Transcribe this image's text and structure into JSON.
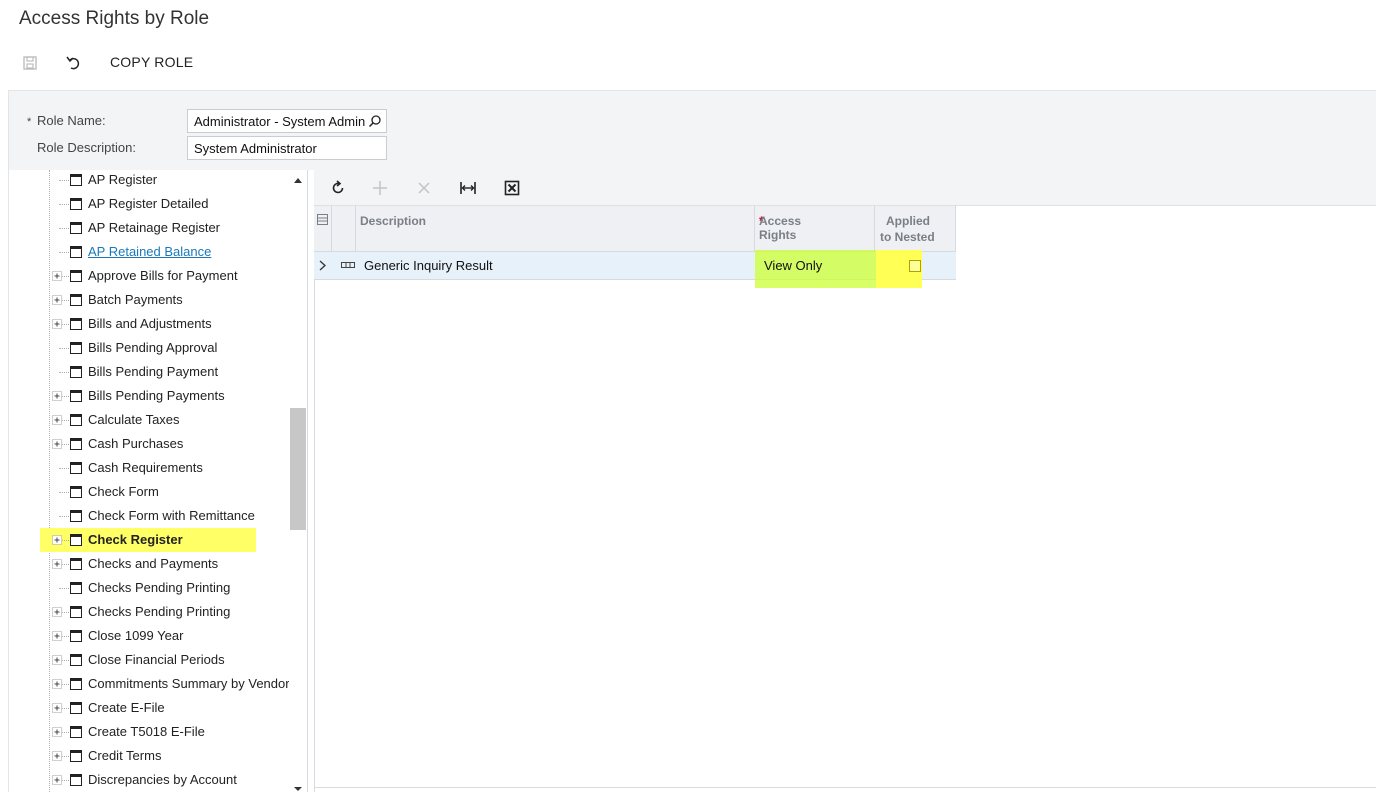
{
  "page": {
    "title": "Access Rights by Role"
  },
  "toolbar": {
    "copy_role_label": "COPY ROLE"
  },
  "form": {
    "role_name_label": "Role Name:",
    "role_name_value": "Administrator - System Admin",
    "role_description_label": "Role Description:",
    "role_description_value": "System Administrator",
    "required_mark": "*"
  },
  "tree": {
    "items": [
      {
        "label": "AP Register",
        "expandable": false
      },
      {
        "label": "AP Register Detailed",
        "expandable": false
      },
      {
        "label": "AP Retainage Register",
        "expandable": false
      },
      {
        "label": "AP Retained Balance",
        "expandable": false,
        "link": true
      },
      {
        "label": "Approve Bills for Payment",
        "expandable": true
      },
      {
        "label": "Batch Payments",
        "expandable": true
      },
      {
        "label": "Bills and Adjustments",
        "expandable": true
      },
      {
        "label": "Bills Pending Approval",
        "expandable": false
      },
      {
        "label": "Bills Pending Payment",
        "expandable": false
      },
      {
        "label": "Bills Pending Payments",
        "expandable": true
      },
      {
        "label": "Calculate Taxes",
        "expandable": true
      },
      {
        "label": "Cash Purchases",
        "expandable": true
      },
      {
        "label": "Cash Requirements",
        "expandable": false
      },
      {
        "label": "Check Form",
        "expandable": false
      },
      {
        "label": "Check Form with Remittance",
        "expandable": false
      },
      {
        "label": "Check Register",
        "expandable": true,
        "selected": true
      },
      {
        "label": "Checks and Payments",
        "expandable": true
      },
      {
        "label": "Checks Pending Printing",
        "expandable": false
      },
      {
        "label": "Checks Pending Printing",
        "expandable": true
      },
      {
        "label": "Close 1099 Year",
        "expandable": true
      },
      {
        "label": "Close Financial Periods",
        "expandable": true
      },
      {
        "label": "Commitments Summary by Vendor",
        "expandable": true
      },
      {
        "label": "Create E-File",
        "expandable": true
      },
      {
        "label": "Create T5018 E-File",
        "expandable": true
      },
      {
        "label": "Credit Terms",
        "expandable": true
      },
      {
        "label": "Discrepancies by Account",
        "expandable": true
      }
    ]
  },
  "grid": {
    "columns": {
      "description": "Description",
      "access_rights": "Access Rights",
      "applied_line1": "Applied",
      "applied_line2": "to Nested"
    },
    "rows": [
      {
        "description": "Generic Inquiry Result",
        "access_rights": "View Only",
        "applied_to_nested": false
      }
    ]
  },
  "colors": {
    "highlight_yellow": "#ffff66",
    "highlight_lime": "#ccff33",
    "link": "#1a7ab8",
    "selected_row": "#e6f1fa"
  }
}
